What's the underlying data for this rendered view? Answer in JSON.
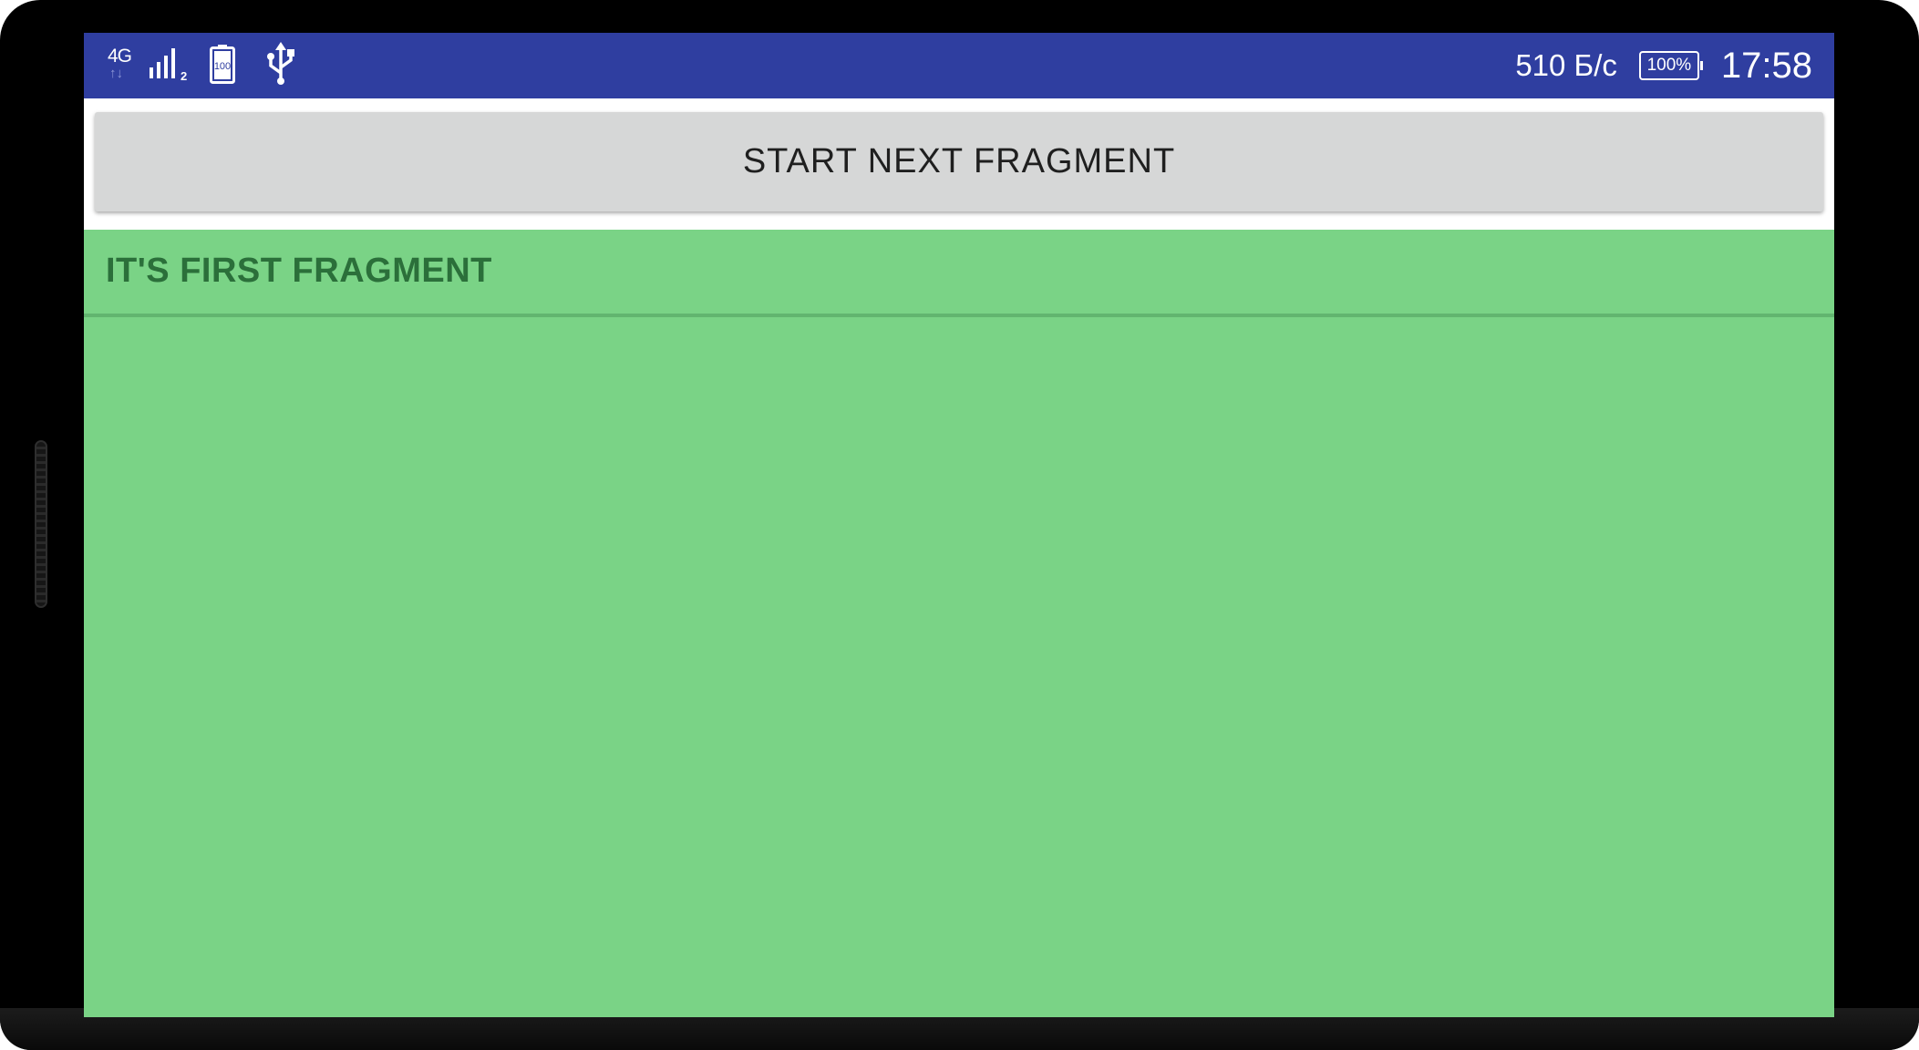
{
  "status_bar": {
    "network_type": "4G",
    "network_arrows": "↑↓",
    "signal_sim": "2",
    "battery_icon_level": "100",
    "network_speed": "510 Б/с",
    "battery_percent": "100%",
    "time": "17:58",
    "background_color": "#2f3ea0",
    "icons": [
      "network-4g-icon",
      "signal-strength-icon",
      "battery-icon",
      "usb-icon"
    ]
  },
  "toolbar": {
    "next_fragment_label": "START NEXT FRAGMENT"
  },
  "fragment": {
    "title": "IT'S FIRST FRAGMENT",
    "background_color": "#7ad386",
    "title_color": "#2b6f3a"
  }
}
